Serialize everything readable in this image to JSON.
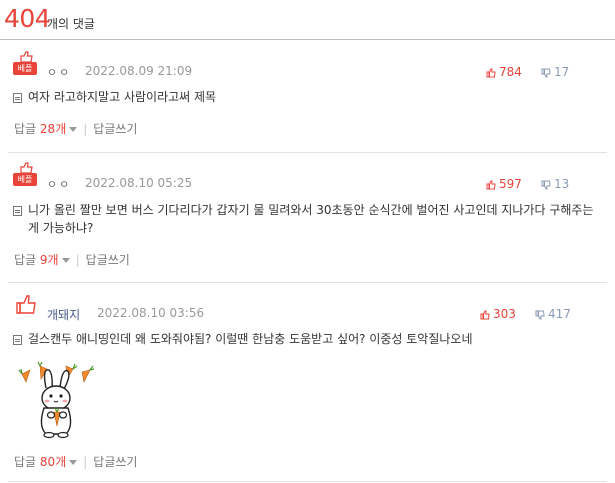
{
  "header": {
    "count": "404",
    "label": "개의 댓글"
  },
  "badge_text": "베플",
  "comments": [
    {
      "nick": "ㅇㅇ",
      "date": "2022.08.09 21:09",
      "likes": "784",
      "dislikes": "17",
      "text": "여자 라고하지말고 사람이라고써 제목",
      "reply_label": "답글",
      "reply_count": "28개",
      "write_reply": "답글쓰기"
    },
    {
      "nick": "ㅇㅇ",
      "date": "2022.08.10 05:25",
      "likes": "597",
      "dislikes": "13",
      "text": "니가 올린 짤만 보면 버스 기다리다가 갑자기 물 밀려와서 30초동안 순식간에 벌어진 사고인데 지나가다 구해주는게 가능하냐?",
      "reply_label": "답글",
      "reply_count": "9개",
      "write_reply": "답글쓰기"
    },
    {
      "nick": "개돼지",
      "date": "2022.08.10 03:56",
      "likes": "303",
      "dislikes": "417",
      "text": "걸스캔두 애니띵인데 왜 도와줘야됨? 이럴땐 한남충 도움받고 싶어? 이중성 토악질나오네",
      "reply_label": "답글",
      "reply_count": "80개",
      "write_reply": "답글쓰기"
    }
  ],
  "colors": {
    "accent": "#e8443a",
    "dislike": "#8a9ab5",
    "nick_named": "#44598c"
  },
  "icons": [
    "thumb-up-icon",
    "thumb-down-icon",
    "memo-icon",
    "caret-down-icon",
    "rabbit-sticker"
  ]
}
